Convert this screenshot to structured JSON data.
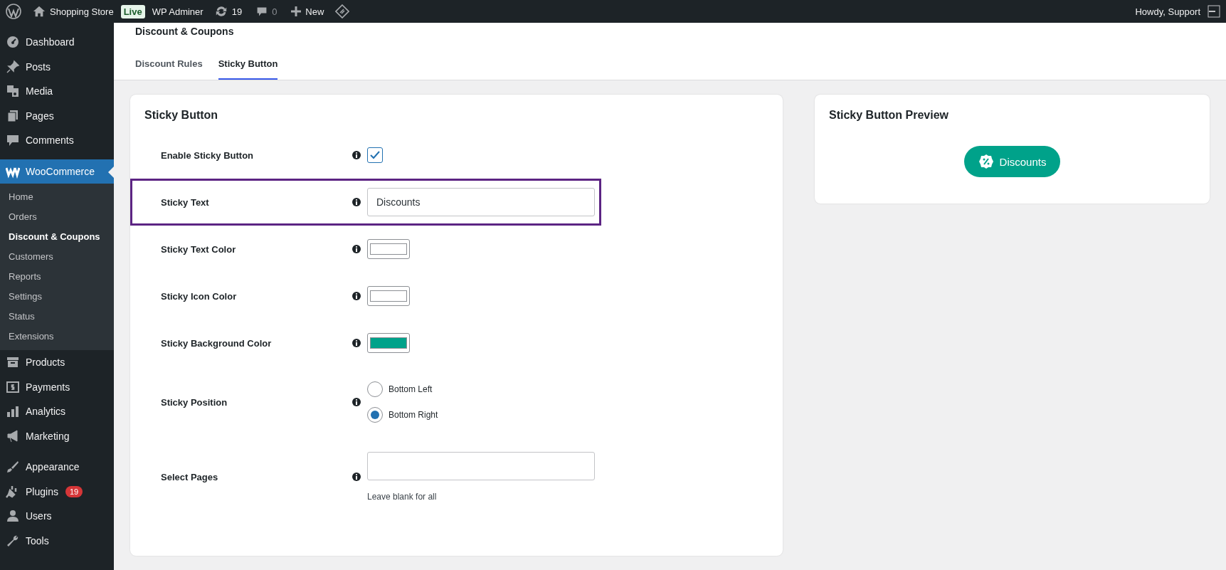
{
  "admin_bar": {
    "site_name": "Shopping Store",
    "env_badge": "Live",
    "user_switch": "WP Adminer",
    "updates_count": "19",
    "comments_count": "0",
    "new_label": "New",
    "greeting": "Howdy, Support"
  },
  "sidebar": {
    "groups": [
      {
        "items": [
          {
            "kind": "dashboard",
            "label": "Dashboard",
            "selected": false
          },
          {
            "kind": "pin",
            "label": "Posts",
            "selected": false
          },
          {
            "kind": "media",
            "label": "Media",
            "selected": false
          },
          {
            "kind": "pages",
            "label": "Pages",
            "selected": false
          },
          {
            "kind": "comment",
            "label": "Comments",
            "selected": false
          }
        ]
      },
      {
        "items": [
          {
            "kind": "woo",
            "label": "WooCommerce",
            "selected": true,
            "children": [
              {
                "label": "Home",
                "selected": false
              },
              {
                "label": "Orders",
                "selected": false
              },
              {
                "label": "Discount & Coupons",
                "selected": true
              },
              {
                "label": "Customers",
                "selected": false
              },
              {
                "label": "Reports",
                "selected": false
              },
              {
                "label": "Settings",
                "selected": false
              },
              {
                "label": "Status",
                "selected": false
              },
              {
                "label": "Extensions",
                "selected": false
              }
            ]
          },
          {
            "kind": "archive",
            "label": "Products",
            "selected": false
          },
          {
            "kind": "dollar",
            "label": "Payments",
            "selected": false
          },
          {
            "kind": "bars",
            "label": "Analytics",
            "selected": false
          },
          {
            "kind": "megaphone",
            "label": "Marketing",
            "selected": false
          }
        ]
      },
      {
        "items": [
          {
            "kind": "brush",
            "label": "Appearance",
            "selected": false
          },
          {
            "kind": "plug",
            "label": "Plugins",
            "badge": "19",
            "selected": false
          },
          {
            "kind": "user",
            "label": "Users",
            "selected": false
          },
          {
            "kind": "wrench",
            "label": "Tools",
            "selected": false
          }
        ]
      }
    ]
  },
  "page": {
    "title": "Discount & Coupons",
    "tabs": [
      {
        "label": "Discount Rules",
        "selected": false
      },
      {
        "label": "Sticky Button",
        "selected": true
      }
    ]
  },
  "settings_card": {
    "title": "Sticky Button",
    "fields": [
      {
        "kind": "checkbox",
        "label": "Enable Sticky Button",
        "checked": true,
        "highlighted": false
      },
      {
        "kind": "text",
        "label": "Sticky Text",
        "value": "Discounts",
        "highlighted": true
      },
      {
        "kind": "color",
        "label": "Sticky Text Color",
        "color": "#ffffff",
        "highlighted": false
      },
      {
        "kind": "color",
        "label": "Sticky Icon Color",
        "color": "#ffffff",
        "highlighted": false
      },
      {
        "kind": "color",
        "label": "Sticky Background Color",
        "color": "#00a28a",
        "highlighted": false
      },
      {
        "kind": "radio",
        "label": "Sticky Position",
        "highlighted": false,
        "options": [
          {
            "label": "Bottom Left",
            "selected": false
          },
          {
            "label": "Bottom Right",
            "selected": true
          }
        ]
      },
      {
        "kind": "text",
        "label": "Select Pages",
        "hint": "Leave blank for all",
        "highlighted": false
      }
    ]
  },
  "preview": {
    "title": "Sticky Button Preview",
    "button_label": "Discounts"
  }
}
